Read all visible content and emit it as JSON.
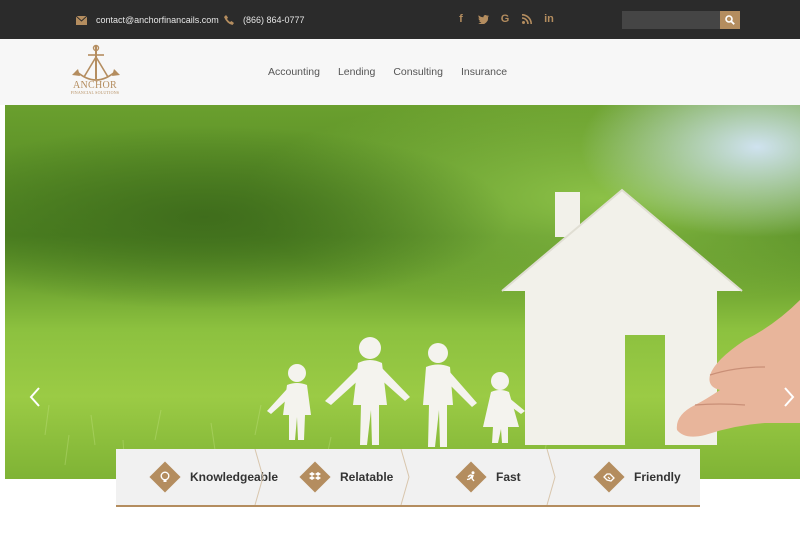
{
  "topbar": {
    "email": "contact@anchorfinancails.com",
    "phone": "(866) 864-0777",
    "social": [
      "f",
      "t",
      "G",
      "rss",
      "in"
    ],
    "search_placeholder": ""
  },
  "logo": {
    "name": "ANCHOR",
    "tagline": "FINANCIAL SOLUTIONS"
  },
  "nav": {
    "items": [
      "Accounting",
      "Lending",
      "Consulting",
      "Insurance"
    ]
  },
  "features": [
    {
      "label": "Knowledgeable",
      "icon": "lightbulb-icon"
    },
    {
      "label": "Relatable",
      "icon": "dropbox-icon"
    },
    {
      "label": "Fast",
      "icon": "running-icon"
    },
    {
      "label": "Friendly",
      "icon": "handshake-icon"
    }
  ],
  "colors": {
    "accent": "#b48d5f",
    "topbar": "#2b2b2b",
    "header": "#f7f7f7"
  }
}
